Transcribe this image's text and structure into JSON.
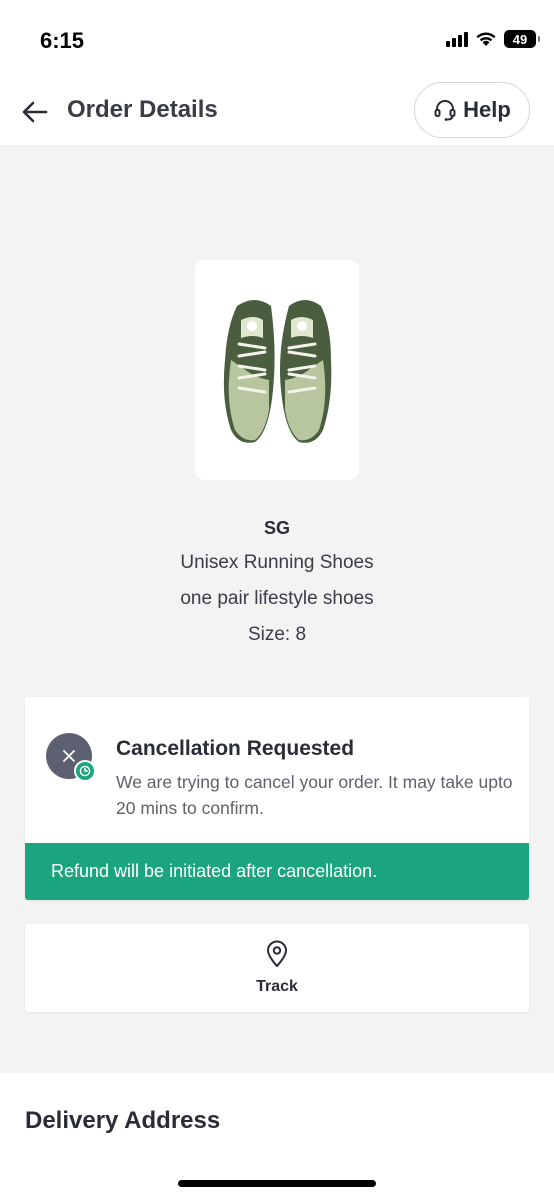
{
  "status_bar": {
    "time": "6:15",
    "battery": "49",
    "icons": [
      "cellular-signal-icon",
      "wifi-icon",
      "battery-icon"
    ]
  },
  "header": {
    "title": "Order Details",
    "back_icon": "arrow-left-icon",
    "help_label": "Help",
    "help_icon": "headset-icon"
  },
  "product": {
    "brand": "SG",
    "name": "Unisex Running Shoes",
    "description": "one pair lifestyle shoes",
    "size": "Size: 8",
    "image_icon": "running-shoes-image"
  },
  "cancellation": {
    "title": "Cancellation Requested",
    "description": "We are trying to cancel your order. It may take upto 20 mins to confirm.",
    "refund_note": "Refund will be initiated after cancellation.",
    "icon": "cancel-x-icon",
    "badge_icon": "clock-icon"
  },
  "track": {
    "label": "Track",
    "icon": "location-pin-icon"
  },
  "delivery": {
    "title": "Delivery Address"
  },
  "colors": {
    "accent_green": "#1aa57e",
    "page_bg": "#f3f3f3",
    "text_dark": "#2b2d36",
    "cancel_icon_bg": "#5d6070"
  }
}
